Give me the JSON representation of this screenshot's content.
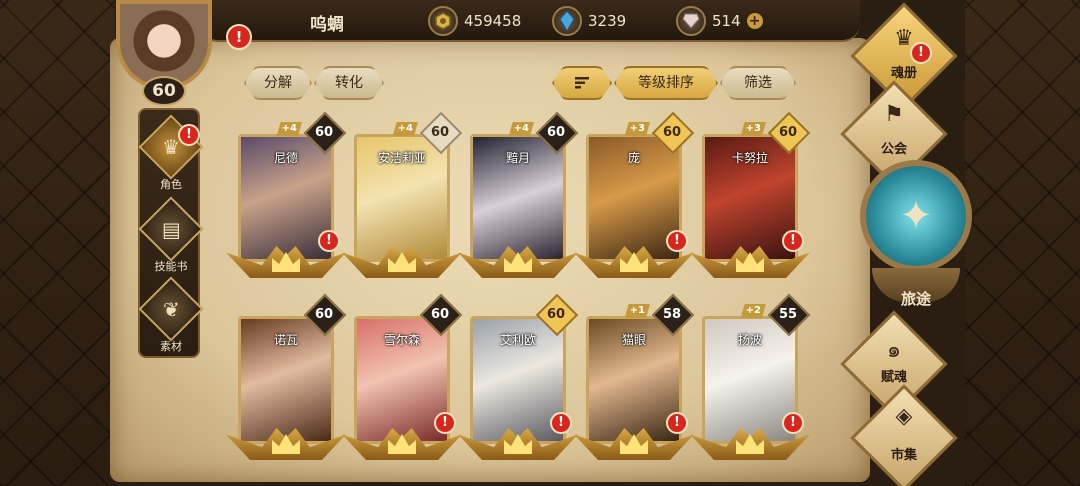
{
  "header": {
    "player_name": "呜蜩",
    "avatar_level": "60",
    "currencies": [
      {
        "icon": "gold-coin-icon",
        "value": "459458"
      },
      {
        "icon": "blue-crystal-icon",
        "value": "3239"
      },
      {
        "icon": "pink-gem-icon",
        "value": "514"
      }
    ],
    "plus_label": "+",
    "alert_mark": "!"
  },
  "left_tabs": [
    {
      "label": "角色",
      "icon": "helmet-icon",
      "active": true
    },
    {
      "label": "技能书",
      "icon": "skill-book-icon",
      "active": false
    },
    {
      "label": "素材",
      "icon": "material-icon",
      "active": false
    }
  ],
  "toolbar": {
    "decompose": "分解",
    "convert": "转化",
    "sort_level": "等级排序",
    "filter": "筛选"
  },
  "cards": [
    {
      "name": "尼德",
      "level": "60",
      "plus": "+4",
      "badge_style": "dark",
      "alert": true
    },
    {
      "name": "安洁莉亚",
      "level": "60",
      "plus": "+4",
      "badge_style": "light",
      "alert": false
    },
    {
      "name": "黯月",
      "level": "60",
      "plus": "+4",
      "badge_style": "dark",
      "alert": false
    },
    {
      "name": "庞",
      "level": "60",
      "plus": "+3",
      "badge_style": "gold",
      "alert": true
    },
    {
      "name": "卡努拉",
      "level": "60",
      "plus": "+3",
      "badge_style": "gold",
      "alert": true
    },
    {
      "name": "诺瓦",
      "level": "60",
      "plus": "",
      "badge_style": "dark",
      "alert": false
    },
    {
      "name": "雪尔森",
      "level": "60",
      "plus": "",
      "badge_style": "dark",
      "alert": true
    },
    {
      "name": "艾利欧",
      "level": "60",
      "plus": "",
      "badge_style": "gold",
      "alert": true
    },
    {
      "name": "猫眼",
      "level": "58",
      "plus": "+1",
      "badge_style": "dark",
      "alert": true
    },
    {
      "name": "扬波",
      "level": "55",
      "plus": "+2",
      "badge_style": "dark",
      "alert": true
    }
  ],
  "right_menu": {
    "soul_book": "魂册",
    "guild": "公会",
    "journey": "旅途",
    "endow_soul": "赋魂",
    "market": "市集"
  }
}
